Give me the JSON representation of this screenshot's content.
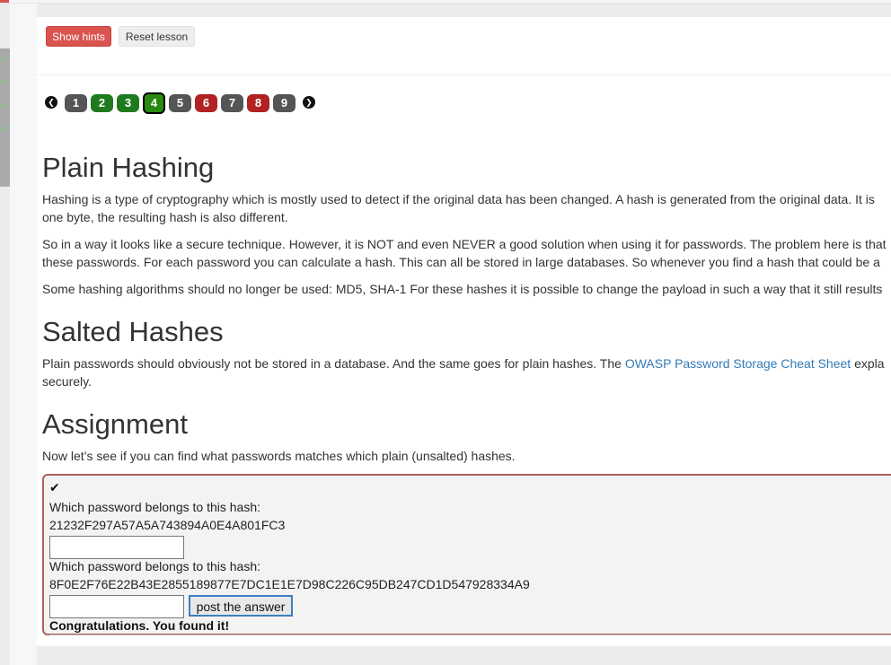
{
  "toolbar": {
    "show_hints_label": "Show hints",
    "reset_lesson_label": "Reset lesson"
  },
  "pager": {
    "prev_glyph": "❮",
    "next_glyph": "❯",
    "pages": [
      {
        "label": "1",
        "state": "grey"
      },
      {
        "label": "2",
        "state": "green"
      },
      {
        "label": "3",
        "state": "green"
      },
      {
        "label": "4",
        "state": "current"
      },
      {
        "label": "5",
        "state": "grey"
      },
      {
        "label": "6",
        "state": "red"
      },
      {
        "label": "7",
        "state": "grey"
      },
      {
        "label": "8",
        "state": "red"
      },
      {
        "label": "9",
        "state": "grey"
      }
    ]
  },
  "content": {
    "plain_hashing_title": "Plain Hashing",
    "p1_line1": "Hashing is a type of cryptography which is mostly used to detect if the original data has been changed. A hash is generated from the original data. It is",
    "p1_line2": "one byte, the resulting hash is also different.",
    "p2_line1": "So in a way it looks like a secure technique. However, it is NOT and even NEVER a good solution when using it for passwords. The problem here is that",
    "p2_line2": "these passwords. For each password you can calculate a hash. This can all be stored in large databases. So whenever you find a hash that could be a",
    "p3_line1": "Some hashing algorithms should no longer be used: MD5, SHA-1 For these hashes it is possible to change the payload in such a way that it still results",
    "salted_title": "Salted Hashes",
    "p4_before_link": "Plain passwords should obviously not be stored in a database. And the same goes for plain hashes. The ",
    "p4_link": "OWASP Password Storage Cheat Sheet",
    "p4_after_link": " expla",
    "p4_line2": "securely.",
    "assignment_title": "Assignment",
    "p5_line1": "Now let’s see if you can find what passwords matches which plain (unsalted) hashes."
  },
  "assignment": {
    "check_glyph": "✔",
    "q1_label": "Which password belongs to this hash:",
    "q1_hash": "21232F297A57A5A743894A0E4A801FC3",
    "q1_value": "",
    "q2_label": "Which password belongs to this hash:",
    "q2_hash": "8F0E2F76E22B43E2855189877E7DC1E1E7D98C226C95DB247CD1D547928334A9",
    "q2_value": "",
    "submit_label": "post the answer",
    "feedback": "Congratulations. You found it!"
  },
  "colors": {
    "danger": "#d9534f",
    "success": "#1f7a1f",
    "link": "#337ab7",
    "box_border": "#b0605f"
  }
}
